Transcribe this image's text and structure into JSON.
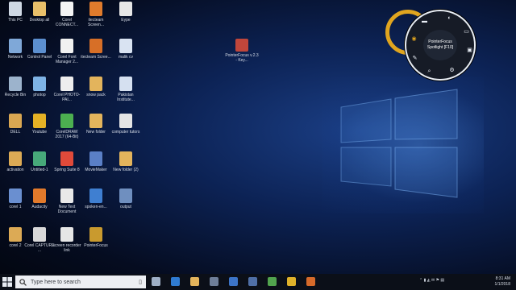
{
  "desktop": {
    "icons": [
      {
        "label": "This PC",
        "icon": "computer-icon",
        "color": "#cfd8e4"
      },
      {
        "label": "Desktop all",
        "icon": "folder-icon",
        "color": "#e9c06a"
      },
      {
        "label": "Corel CONNECT...",
        "icon": "corel-connect-icon",
        "color": "#f4f4f4"
      },
      {
        "label": "itecteam Screen...",
        "icon": "screen-recorder-icon",
        "color": "#e07b2c"
      },
      {
        "label": "Eype",
        "icon": "document-icon",
        "color": "#e6e6e6"
      },
      {
        "label": "Network",
        "icon": "network-icon",
        "color": "#7fa8d8"
      },
      {
        "label": "Control Panel",
        "icon": "control-panel-icon",
        "color": "#5c8fcf"
      },
      {
        "label": "Corel Font Manager 2...",
        "icon": "font-manager-icon",
        "color": "#f1f1f1"
      },
      {
        "label": "itecteam Scree...",
        "icon": "screen-recorder-icon",
        "color": "#d76f27"
      },
      {
        "label": "malik cv",
        "icon": "word-doc-icon",
        "color": "#d9e3f2"
      },
      {
        "label": "Recycle Bin",
        "icon": "recycle-bin-icon",
        "color": "#9cb3cc"
      },
      {
        "label": "photop",
        "icon": "image-icon",
        "color": "#7eb3e5"
      },
      {
        "label": "Corel PHOTO-PAI...",
        "icon": "corel-photo-icon",
        "color": "#eeeeee"
      },
      {
        "label": "snow pack",
        "icon": "folder-icon",
        "color": "#e3b45c"
      },
      {
        "label": "Pakistan Institute...",
        "icon": "word-doc-icon",
        "color": "#d5e0f0"
      },
      {
        "label": "DELL",
        "icon": "folder-icon",
        "color": "#d9a752"
      },
      {
        "label": "Youtube",
        "icon": "chrome-icon",
        "color": "#e5b125"
      },
      {
        "label": "CorelDRAW 2017 (64-Bit)",
        "icon": "coreldraw-icon",
        "color": "#4caf50"
      },
      {
        "label": "New folder",
        "icon": "folder-icon",
        "color": "#e3b45c"
      },
      {
        "label": "computer tutors",
        "icon": "document-icon",
        "color": "#e4e4e4"
      },
      {
        "label": "activation",
        "icon": "folder-icon",
        "color": "#dcaa55"
      },
      {
        "label": "Untitled-1",
        "icon": "image-icon",
        "color": "#47a97a"
      },
      {
        "label": "Spring Suite 8",
        "icon": "kingsoft-icon",
        "color": "#e04a3a"
      },
      {
        "label": "MovieMaker",
        "icon": "moviemaker-icon",
        "color": "#5a7fc6"
      },
      {
        "label": "New folder (2)",
        "icon": "folder-icon",
        "color": "#e3b45c"
      },
      {
        "label": "corel 1",
        "icon": "word-doc-icon",
        "color": "#6a8fd0"
      },
      {
        "label": "Audacity",
        "icon": "audacity-icon",
        "color": "#e27a2b"
      },
      {
        "label": "New Text Document",
        "icon": "text-document-icon",
        "color": "#e8e8e8"
      },
      {
        "label": "spoken-en...",
        "icon": "edge-file-icon",
        "color": "#3f7fd1"
      },
      {
        "label": "output",
        "icon": "folder-icon",
        "color": "#6f8fbf"
      },
      {
        "label": "corel 2",
        "icon": "folder-icon",
        "color": "#dcaa55"
      },
      {
        "label": "Corel CAPTURE ...",
        "icon": "corel-capture-icon",
        "color": "#d8d8d8"
      },
      {
        "label": "screen recorder link",
        "icon": "text-document-icon",
        "color": "#e6e6e6"
      },
      {
        "label": "PointerFocus",
        "icon": "pointerfocus-icon",
        "color": "#c99a2e"
      }
    ],
    "center_icon": {
      "label": "PointerFocus v.2.3 - Key...",
      "icon": "archive-icon",
      "color": "#c0463b"
    }
  },
  "radial_menu": {
    "center_text_line1": "PointerFocus",
    "center_text_line2": "Spotlight [F10]",
    "items": [
      {
        "icon": "folder-icon",
        "glyph": "▬"
      },
      {
        "icon": "spotlight-icon",
        "glyph": "◐"
      },
      {
        "icon": "keystroke-icon",
        "glyph": "▭"
      },
      {
        "icon": "monitor-icon",
        "glyph": "▣"
      },
      {
        "icon": "settings-icon",
        "glyph": "⚙"
      },
      {
        "icon": "search-icon",
        "glyph": "⌕"
      },
      {
        "icon": "pen-icon",
        "glyph": "✎"
      },
      {
        "icon": "cursor-icon",
        "glyph": "◉"
      }
    ],
    "highlight_color": "#e0a51f"
  },
  "taskbar": {
    "search_placeholder": "Type here to search",
    "time": "8:31 AM",
    "date": "1/1/2018",
    "apps": [
      {
        "icon": "task-view-icon",
        "color": "#9fb0c7"
      },
      {
        "icon": "edge-icon",
        "color": "#2f7bd1"
      },
      {
        "icon": "file-explorer-icon",
        "color": "#e3b45c"
      },
      {
        "icon": "store-icon",
        "color": "#6e7e98"
      },
      {
        "icon": "mail-icon",
        "color": "#3c74c7"
      },
      {
        "icon": "photos-icon",
        "color": "#4f6fa6"
      },
      {
        "icon": "coreldraw-icon",
        "color": "#52a44e"
      },
      {
        "icon": "chrome-icon",
        "color": "#e0b22a"
      },
      {
        "icon": "media-icon",
        "color": "#d66a2a"
      }
    ],
    "tray_glyphs": "⌃ ▮ ◭ ✉ ⚑ ▤"
  }
}
